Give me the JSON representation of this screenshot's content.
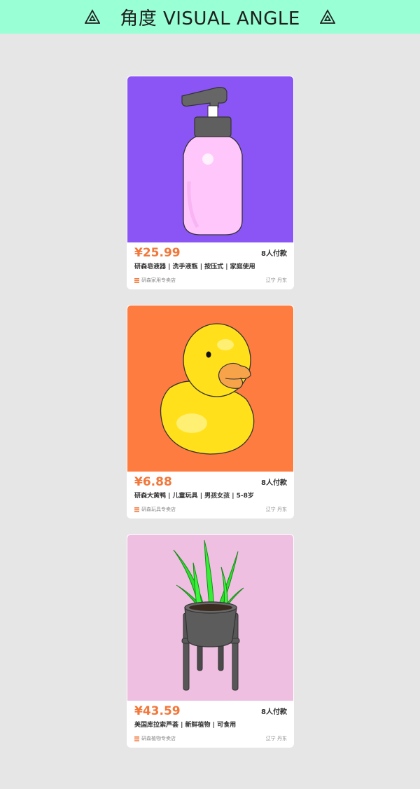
{
  "header": {
    "title": "角度 VISUAL ANGLE",
    "icon": "triangle-logo-icon"
  },
  "colors": {
    "header_bg": "#99ffd4",
    "page_bg": "#e6e6e6",
    "price": "#f2773a",
    "store_icon": "#f2773a"
  },
  "products": [
    {
      "image": "soap-dispenser-illustration",
      "image_bg": "#8b55f5",
      "price": "¥25.99",
      "sold": "8人付款",
      "title": "研森皂液器 | 洗手液瓶 | 按压式 | 家庭使用",
      "store_icon": "store-icon",
      "store": "研森家用专卖店",
      "location": "辽宁 丹东"
    },
    {
      "image": "rubber-duck-illustration",
      "image_bg": "#fe7c3f",
      "price": "¥6.88",
      "sold": "8人付款",
      "title": "研森大黄鸭 | 儿童玩具 | 男孩女孩 | 5-8岁",
      "store_icon": "store-icon",
      "store": "研森玩具专卖店",
      "location": "辽宁 丹东"
    },
    {
      "image": "potted-aloe-plant-illustration",
      "image_bg": "#eebfe0",
      "price": "¥43.59",
      "sold": "8人付款",
      "title": "美国库拉索芦荟 | 新鲜植物 | 可食用",
      "store_icon": "store-icon",
      "store": "研森植物专卖店",
      "location": "辽宁 丹东"
    }
  ]
}
